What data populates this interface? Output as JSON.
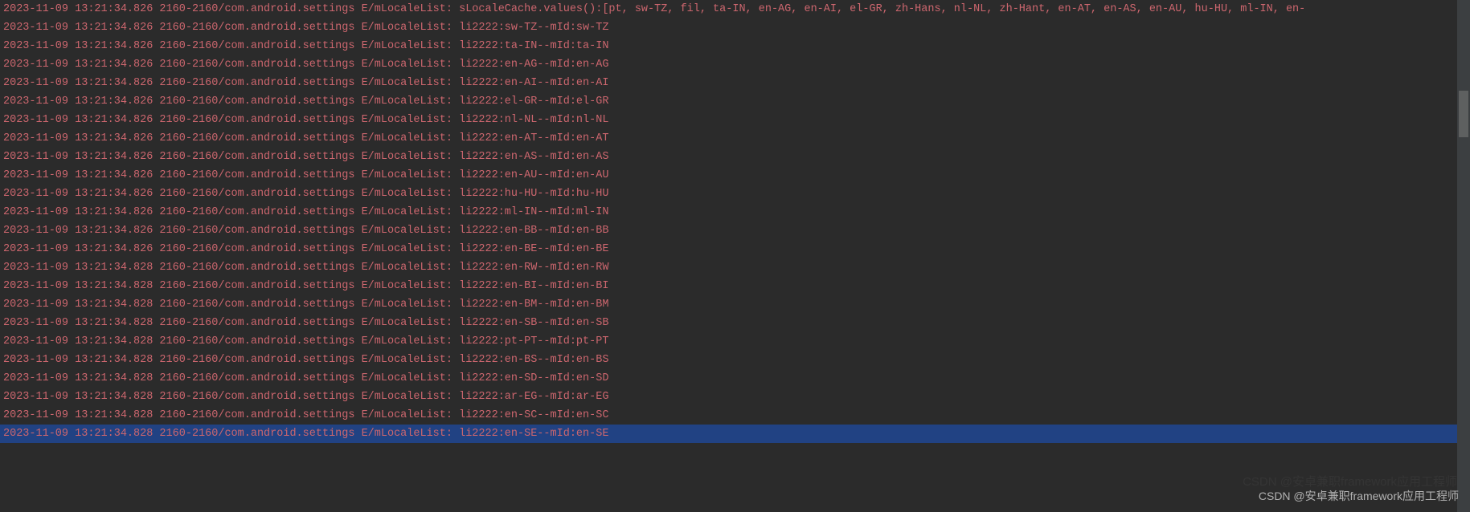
{
  "colors": {
    "bg": "#2b2b2b",
    "text": "#cc666e",
    "selection": "#214283",
    "scrollbar_track": "#3c3f41",
    "scrollbar_thumb": "#5e6060"
  },
  "watermark": "CSDN @安卓兼职framework应用工程师",
  "lines": [
    "2023-11-09 13:21:34.826 2160-2160/com.android.settings E/mLocaleList: sLocaleCache.values():[pt, sw-TZ, fil, ta-IN, en-AG, en-AI, el-GR, zh-Hans, nl-NL, zh-Hant, en-AT, en-AS, en-AU, hu-HU, ml-IN, en-",
    "2023-11-09 13:21:34.826 2160-2160/com.android.settings E/mLocaleList: li2222:sw-TZ--mId:sw-TZ",
    "2023-11-09 13:21:34.826 2160-2160/com.android.settings E/mLocaleList: li2222:ta-IN--mId:ta-IN",
    "2023-11-09 13:21:34.826 2160-2160/com.android.settings E/mLocaleList: li2222:en-AG--mId:en-AG",
    "2023-11-09 13:21:34.826 2160-2160/com.android.settings E/mLocaleList: li2222:en-AI--mId:en-AI",
    "2023-11-09 13:21:34.826 2160-2160/com.android.settings E/mLocaleList: li2222:el-GR--mId:el-GR",
    "2023-11-09 13:21:34.826 2160-2160/com.android.settings E/mLocaleList: li2222:nl-NL--mId:nl-NL",
    "2023-11-09 13:21:34.826 2160-2160/com.android.settings E/mLocaleList: li2222:en-AT--mId:en-AT",
    "2023-11-09 13:21:34.826 2160-2160/com.android.settings E/mLocaleList: li2222:en-AS--mId:en-AS",
    "2023-11-09 13:21:34.826 2160-2160/com.android.settings E/mLocaleList: li2222:en-AU--mId:en-AU",
    "2023-11-09 13:21:34.826 2160-2160/com.android.settings E/mLocaleList: li2222:hu-HU--mId:hu-HU",
    "2023-11-09 13:21:34.826 2160-2160/com.android.settings E/mLocaleList: li2222:ml-IN--mId:ml-IN",
    "2023-11-09 13:21:34.826 2160-2160/com.android.settings E/mLocaleList: li2222:en-BB--mId:en-BB",
    "2023-11-09 13:21:34.826 2160-2160/com.android.settings E/mLocaleList: li2222:en-BE--mId:en-BE",
    "2023-11-09 13:21:34.828 2160-2160/com.android.settings E/mLocaleList: li2222:en-RW--mId:en-RW",
    "2023-11-09 13:21:34.828 2160-2160/com.android.settings E/mLocaleList: li2222:en-BI--mId:en-BI",
    "2023-11-09 13:21:34.828 2160-2160/com.android.settings E/mLocaleList: li2222:en-BM--mId:en-BM",
    "2023-11-09 13:21:34.828 2160-2160/com.android.settings E/mLocaleList: li2222:en-SB--mId:en-SB",
    "2023-11-09 13:21:34.828 2160-2160/com.android.settings E/mLocaleList: li2222:pt-PT--mId:pt-PT",
    "2023-11-09 13:21:34.828 2160-2160/com.android.settings E/mLocaleList: li2222:en-BS--mId:en-BS",
    "2023-11-09 13:21:34.828 2160-2160/com.android.settings E/mLocaleList: li2222:en-SD--mId:en-SD",
    "2023-11-09 13:21:34.828 2160-2160/com.android.settings E/mLocaleList: li2222:ar-EG--mId:ar-EG",
    "2023-11-09 13:21:34.828 2160-2160/com.android.settings E/mLocaleList: li2222:en-SC--mId:en-SC",
    "2023-11-09 13:21:34.828 2160-2160/com.android.settings E/mLocaleList: li2222:en-SE--mId:en-SE"
  ],
  "selected_index": 23
}
